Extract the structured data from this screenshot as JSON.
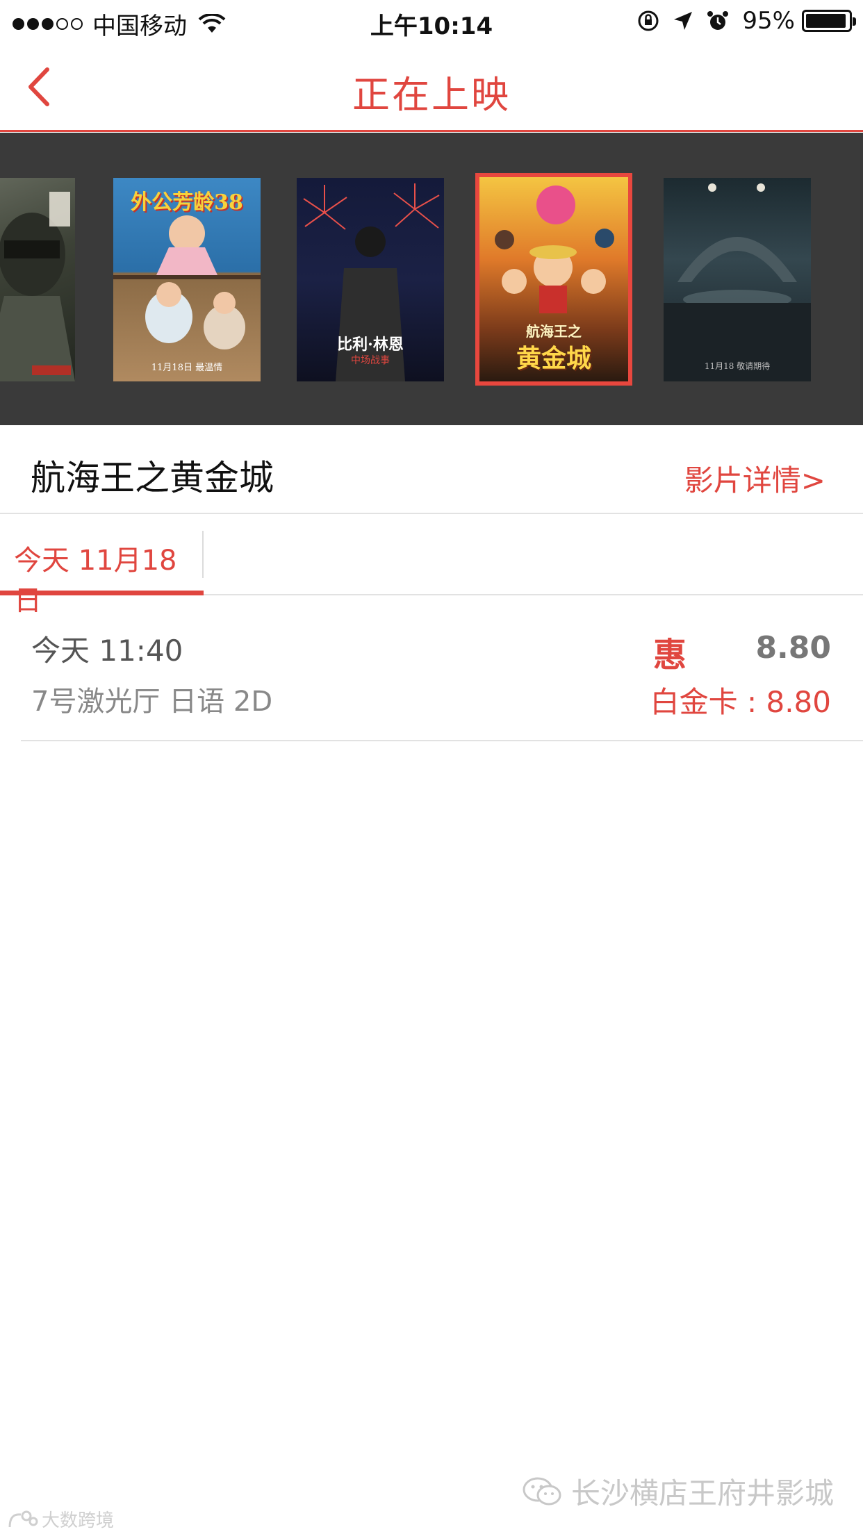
{
  "status_bar": {
    "carrier": "中国移动",
    "time": "上午10:14",
    "battery": "95%",
    "battery_level": 0.95
  },
  "nav": {
    "title": "正在上映"
  },
  "posters": [
    {
      "title_text": "",
      "selected": false
    },
    {
      "title_text": "外公芳龄38",
      "date_text": "11月18日 最温情",
      "selected": false
    },
    {
      "title_text": "比利·林恩",
      "subtitle_text": "中场战事",
      "selected": false
    },
    {
      "title_text": "航海王之",
      "subtitle_text": "黄金城",
      "selected": true
    },
    {
      "title_text": "",
      "date_text": "11月18 敬请期待",
      "selected": false
    }
  ],
  "movie": {
    "title": "航海王之黄金城",
    "detail_link": "影片详情>"
  },
  "date_tab": {
    "label": "今天 11月18日"
  },
  "showtimes": [
    {
      "time": "今天 11:40",
      "hall": "7号激光厅 日语 2D",
      "badge": "惠",
      "price": "8.80",
      "card_price": "白金卡 : 8.80"
    }
  ],
  "watermark": {
    "right": "长沙横店王府井影城",
    "left": "大数跨境"
  },
  "colors": {
    "accent": "#e0463f",
    "strip_background": "#3a3a3a"
  }
}
